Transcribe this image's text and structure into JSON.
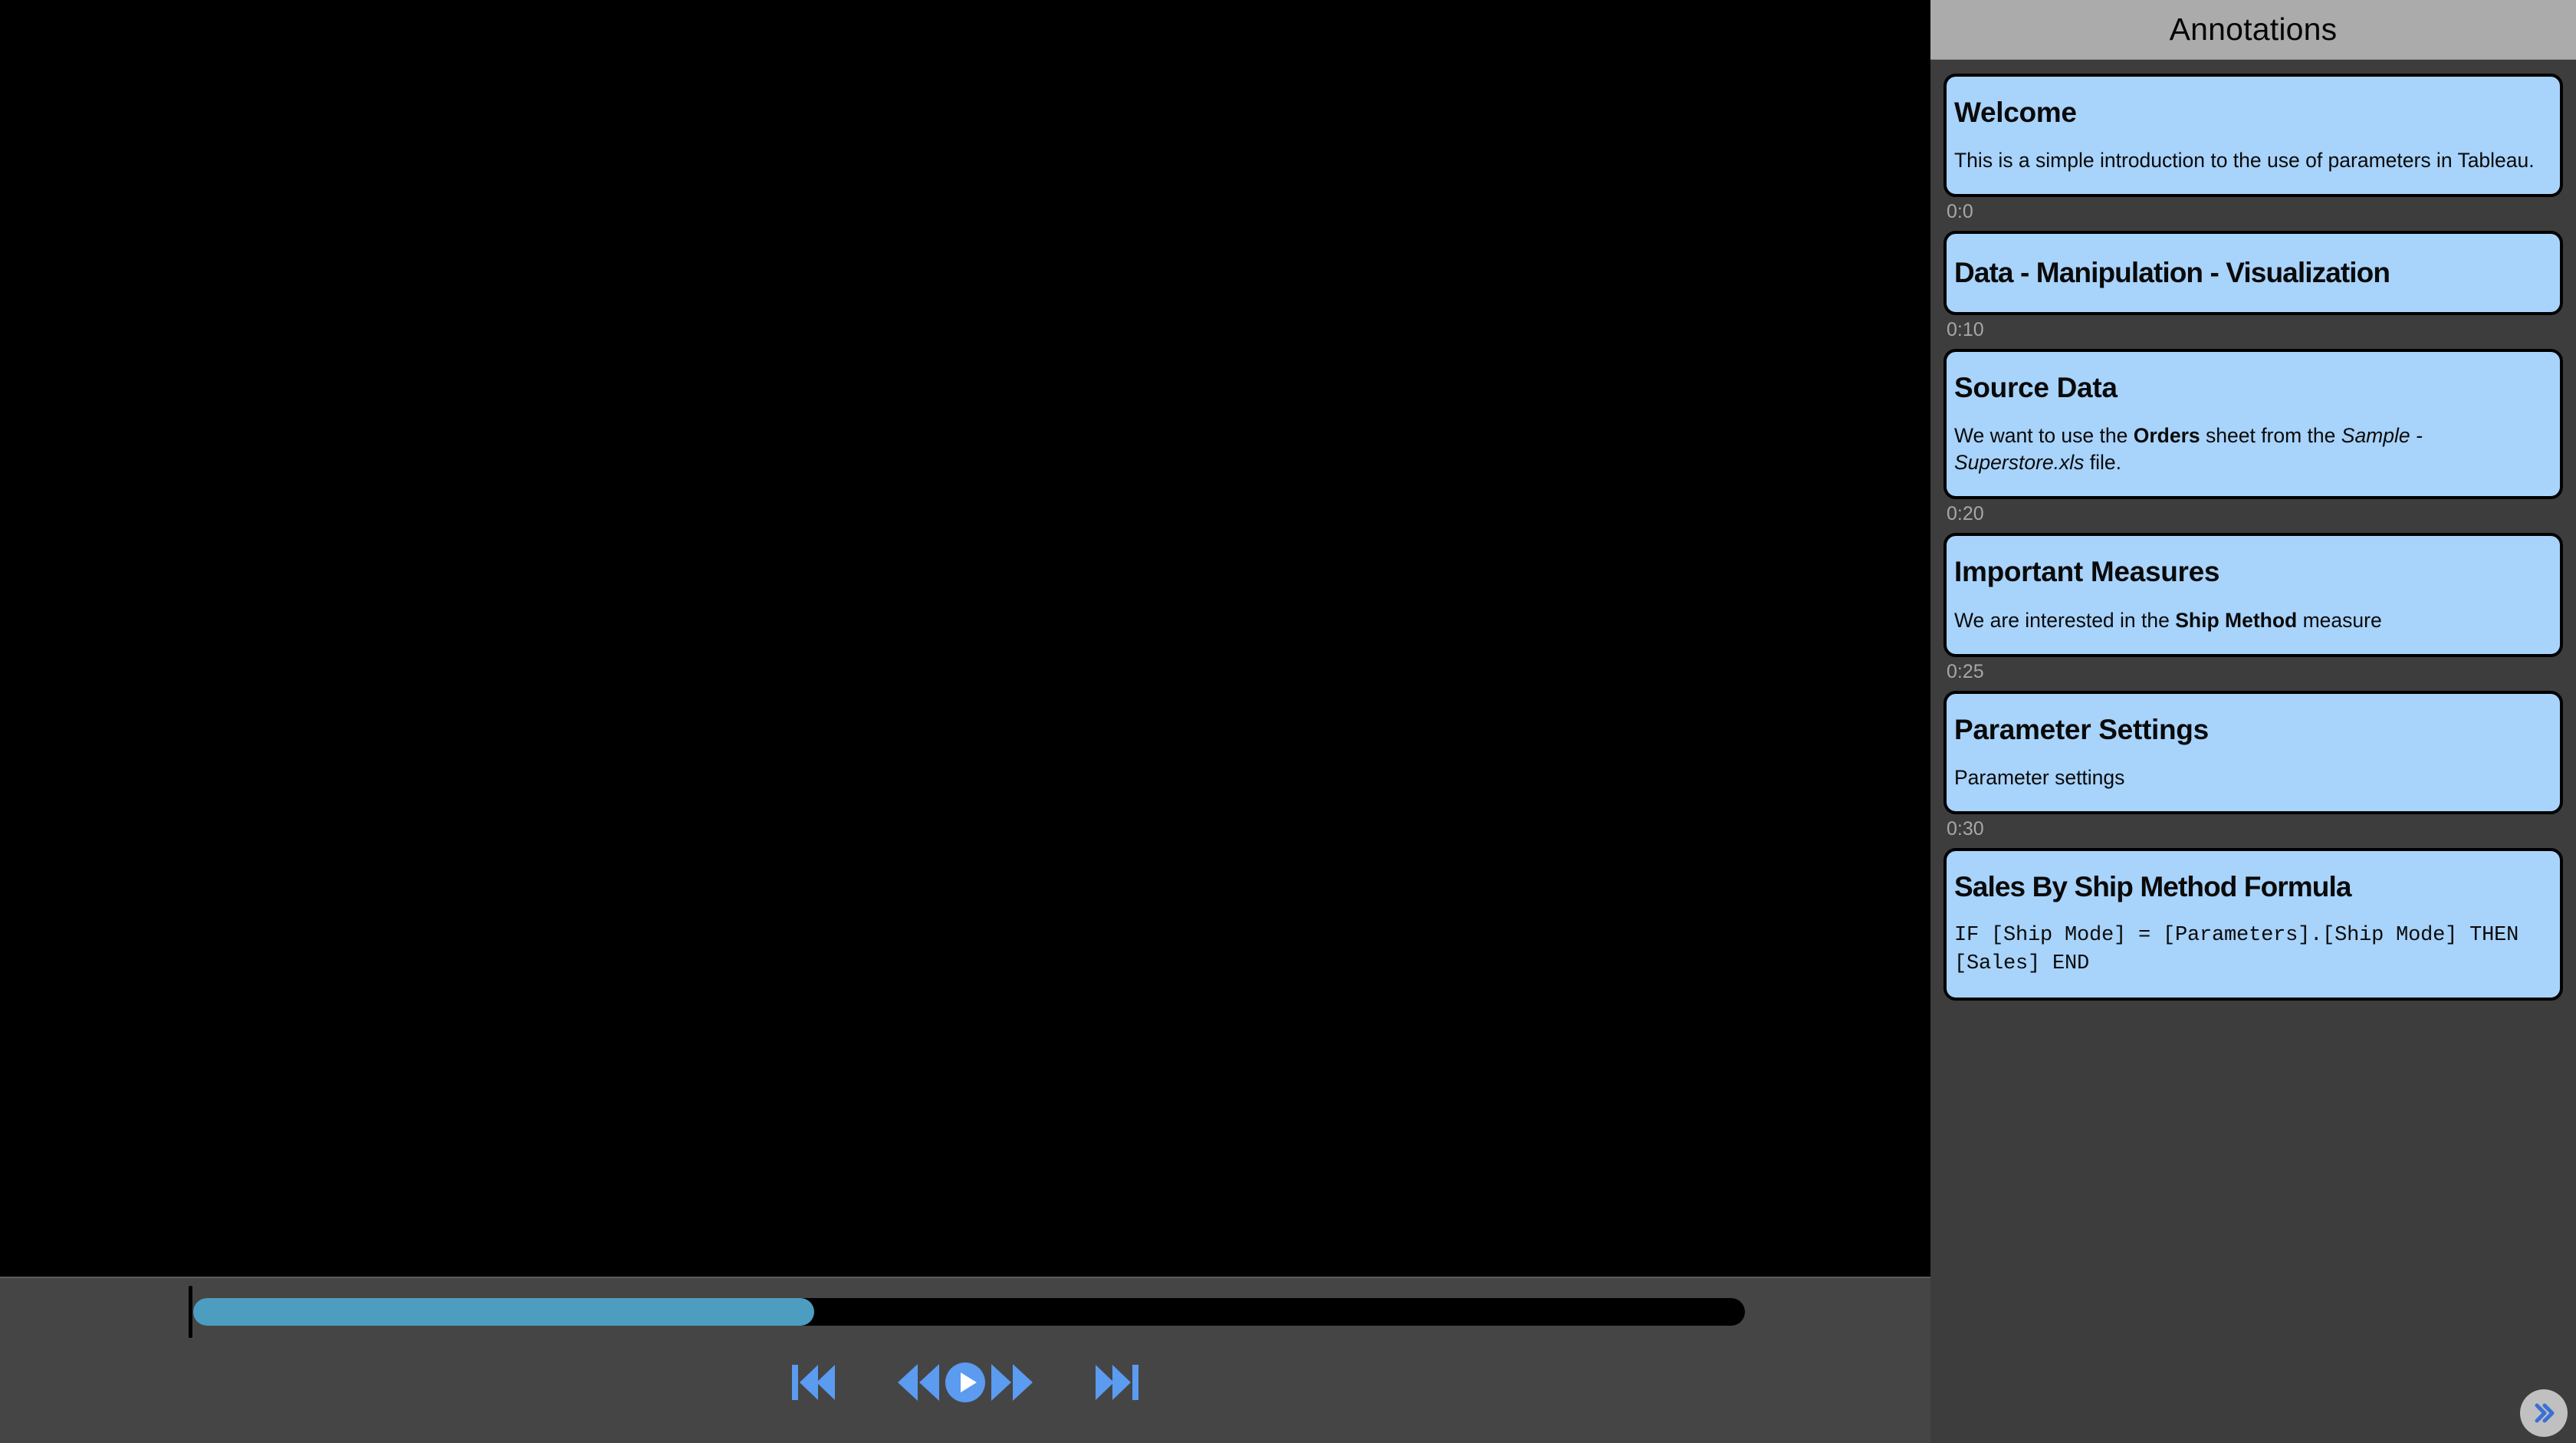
{
  "player": {
    "seek": {
      "progress_percent": 40,
      "fill_color": "#4d9dc0",
      "track_color": "#000000"
    },
    "controls": [
      {
        "name": "skip-to-start-button",
        "icon": "skip-backward-icon",
        "label": "Skip to start"
      },
      {
        "name": "rewind-button",
        "icon": "rewind-icon",
        "label": "Rewind"
      },
      {
        "name": "play-button",
        "icon": "play-circle-icon",
        "label": "Play"
      },
      {
        "name": "fast-forward-button",
        "icon": "fast-forward-icon",
        "label": "Fast forward"
      },
      {
        "name": "skip-to-end-button",
        "icon": "skip-forward-icon",
        "label": "Skip to end"
      }
    ],
    "control_color": "#5b9bf0"
  },
  "panel": {
    "title": "Annotations",
    "header_bg": "#ababab",
    "body_bg": "#3d3d3d",
    "card_bg": "#a8d3fb",
    "next_button": {
      "label": "Next",
      "icon": "double-chevron-right-icon"
    },
    "annotations": [
      {
        "title": "Welcome",
        "body_html": "This is a simple introduction to the use of parameters in Tableau.",
        "timestamp": "0:0"
      },
      {
        "title": "Data - Manipulation - Visualization",
        "body_html": "",
        "timestamp": "0:10"
      },
      {
        "title": "Source Data",
        "body_html": "We want to use the <b>Orders</b> sheet from the <i>Sample - Superstore.xls</i> file.",
        "timestamp": "0:20"
      },
      {
        "title": "Important Measures",
        "body_html": "We are interested in the <b>Ship Method</b> measure",
        "timestamp": "0:25"
      },
      {
        "title": "Parameter Settings",
        "body_html": "Parameter settings",
        "timestamp": "0:30"
      },
      {
        "title": "Sales By Ship Method Formula",
        "body_html": "IF [Ship Mode] = [Parameters].[Ship Mode] THEN [Sales] END",
        "timestamp": "",
        "mono": true
      }
    ]
  }
}
